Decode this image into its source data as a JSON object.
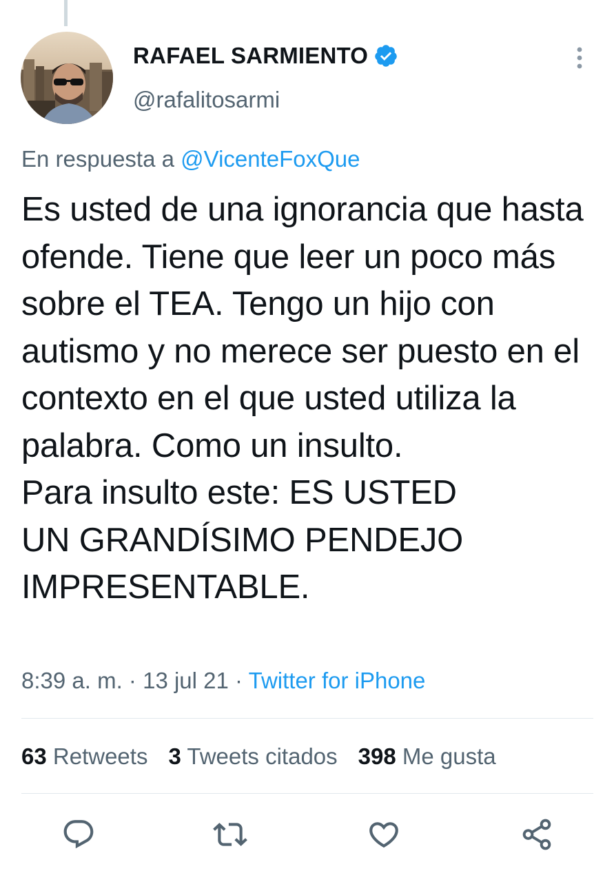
{
  "author": {
    "display_name": "RAFAEL SARMIENTO",
    "handle": "@rafalitosarmi",
    "verified": true,
    "avatar": "avatar-photo"
  },
  "reply": {
    "prefix": "En respuesta a",
    "mention": "@VicenteFoxQue"
  },
  "tweet": {
    "text": "Es usted de una ignorancia que hasta ofende. Tiene que leer un poco más sobre el TEA. Tengo un hijo con autismo y no merece ser puesto en el contexto en el que usted utiliza la palabra. Como un insulto.\nPara insulto este: ES USTED\nUN GRANDÍSIMO PENDEJO IMPRESENTABLE."
  },
  "meta": {
    "time": "8:39 a. m.",
    "separator": "·",
    "date": "13 jul 21",
    "source": "Twitter for iPhone"
  },
  "stats": {
    "retweets_count": "63",
    "retweets_label": "Retweets",
    "quotes_count": "3",
    "quotes_label": "Tweets citados",
    "likes_count": "398",
    "likes_label": "Me gusta"
  },
  "actions": [
    "reply-icon",
    "retweet-icon",
    "like-icon",
    "share-icon"
  ],
  "colors": {
    "link": "#1d9bf0",
    "secondary_text": "#536471",
    "primary_text": "#0f1419",
    "icon": "#536471",
    "divider": "#e1e8ed"
  }
}
